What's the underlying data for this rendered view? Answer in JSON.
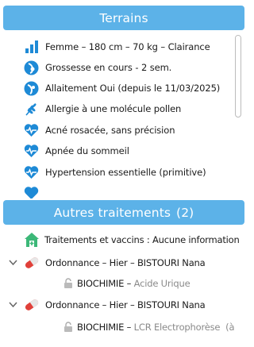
{
  "terrains": {
    "title": "Terrains",
    "items": [
      {
        "icon": "bar-chart-icon",
        "text": "Femme – 180 cm – 70 kg – Clairance"
      },
      {
        "icon": "pregnancy-icon",
        "text": "Grossesse en cours - 2 sem."
      },
      {
        "icon": "breastfeeding-icon",
        "text": "Allaitement Oui (depuis le 11/03/2025)"
      },
      {
        "icon": "pollen-icon",
        "text": "Allergie à une molécule pollen"
      },
      {
        "icon": "heart-pulse-icon",
        "text": "Acné rosacée, sans précision"
      },
      {
        "icon": "heart-pulse-icon",
        "text": "Apnée du sommeil"
      },
      {
        "icon": "heart-pulse-icon",
        "text": "Hypertension essentielle (primitive)"
      }
    ]
  },
  "autres": {
    "title": "Autres traitements",
    "count": "(2)",
    "vaccins": "Traitements et vaccins : Aucune information",
    "ordonnances": [
      {
        "label": "Ordonnance – Hier  – BISTOURI Nana",
        "exam": "BIOCHIMIE",
        "sep": " – ",
        "detail": "Acide Urique"
      },
      {
        "label": "Ordonnance – Hier  – BISTOURI Nana",
        "exam": "BIOCHIMIE",
        "sep": " – ",
        "detail": "LCR Electrophorèse  (à"
      }
    ]
  },
  "colors": {
    "accent": "#5cb2e8",
    "icon_blue": "#1e8ad6",
    "pill_red": "#e0403a",
    "house_green": "#3cb878"
  }
}
